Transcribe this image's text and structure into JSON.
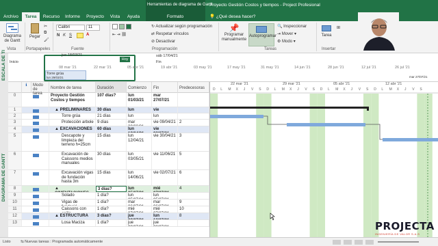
{
  "window": {
    "context_title": "Herramientas de diagrama de Gantt",
    "title": "Proyecto Gestión Costos y tiempos  -  Project Profesional"
  },
  "tabs": [
    {
      "label": "Archivo"
    },
    {
      "label": "Tarea"
    },
    {
      "label": "Recurso"
    },
    {
      "label": "Informe"
    },
    {
      "label": "Proyecto"
    },
    {
      "label": "Vista"
    },
    {
      "label": "Ayuda"
    },
    {
      "label": "Formato"
    }
  ],
  "tell_me": "¿Qué desea hacer?",
  "ribbon": {
    "gantt_label": "Diagrama de Gantt",
    "paste_label": "Pegar",
    "font_name": "Calibri",
    "font_size": "11",
    "bold": "N",
    "italic": "K",
    "underline": "S",
    "update_schedule": "Actualizar según programación",
    "respect_links": "Respetar vínculos",
    "deactivate": "Desactivar",
    "manual_schedule": "Programar manualmente",
    "auto_schedule": "Autoprogramar",
    "inspect": "Inspeccionar",
    "move": "Mover",
    "mode": "Modo",
    "task": "Tarea",
    "groups": {
      "vista": "Vista",
      "portapapeles": "Portapapeles",
      "fuente": "Fuente",
      "programacion": "Programación",
      "tareas": "Tareas",
      "insertar": "Insertar"
    }
  },
  "timeline": {
    "side_label": "ESCALA DE TI",
    "today_label": "Hoy",
    "start_date": "jue 18/03/21",
    "start_label": "Inicio",
    "end_label": "Fin",
    "end_date": "sáb 17/04/21",
    "task_name": "Torre grúa",
    "task_dates": "lun 29/03/21",
    "dates": [
      "08 mar '21",
      "22 mar '21",
      "05 abr '21",
      "19 abr '21",
      "03 may '21",
      "17 may '21",
      "31 may '21",
      "14 jun '21",
      "28 jun '21",
      "12 jul '21",
      "26 jul '21"
    ],
    "corner_date": "mar 27/07/21"
  },
  "grid": {
    "side_label": "DIAGRAMA DE GANTT",
    "headers": {
      "id": "",
      "info": "ℹ",
      "mode": "Modo de tarea",
      "name": "Nombre de tarea",
      "duration": "Duración",
      "start": "Comienzo",
      "finish": "Fin",
      "predecessors": "Predecesoras"
    },
    "rows": [
      {
        "id": "0",
        "name": "Proyecto Gestión Costos y tiempos",
        "duration": "107 días?",
        "start": "lun 01/03/21",
        "finish": "mar 27/07/21",
        "pred": "",
        "kind": "project"
      },
      {
        "id": "1",
        "name": "▲ PRELIMINARES",
        "duration": "30 días",
        "start": "lun 01/03/21",
        "finish": "vie 09/04/21",
        "pred": "",
        "kind": "phase"
      },
      {
        "id": "2",
        "name": "Torre grúa",
        "duration": "21 días",
        "start": "lun 01/03/21",
        "finish": "lun 29/03/21",
        "pred": "",
        "kind": "task"
      },
      {
        "id": "3",
        "name": "Protección arbole",
        "duration": "9 días",
        "start": "mar 30/03/21",
        "finish": "vie 09/04/21",
        "pred": "2",
        "kind": "task"
      },
      {
        "id": "4",
        "name": "▲ EXCAVACIONES",
        "duration": "60 días",
        "start": "lun 12/04/21",
        "finish": "vie 02/07/21",
        "pred": "",
        "kind": "phase"
      },
      {
        "id": "5",
        "name": "Descapote y limpieza del terreno h=25cm",
        "duration": "15 días",
        "start": "lun 12/04/21",
        "finish": "vie 30/04/21",
        "pred": "3",
        "kind": "task"
      },
      {
        "id": "6",
        "name": "Excavación de Caissons medios manuales",
        "duration": "30 días",
        "start": "lun 03/05/21",
        "finish": "vie 11/06/21",
        "pred": "5",
        "kind": "task"
      },
      {
        "id": "7",
        "name": "Excavación vigas de fundación hasta 3m",
        "duration": "15 días",
        "start": "lun 14/06/21",
        "finish": "vie 02/07/21",
        "pred": "6",
        "kind": "task"
      },
      {
        "id": "8",
        "name": "▲ CIMENTACIONES",
        "duration": "3 días?",
        "start": "lun 05/07/21",
        "finish": "mié 07/07/21",
        "pred": "4",
        "kind": "phase"
      },
      {
        "id": "9",
        "name": "Solado",
        "duration": "1 día?",
        "start": "lun 05/07/21",
        "finish": "lun 05/07/21",
        "pred": "",
        "kind": "task"
      },
      {
        "id": "10",
        "name": "Vigas de fundació",
        "duration": "1 día?",
        "start": "mar 06/07/21",
        "finish": "mar 06/07/21",
        "pred": "9",
        "kind": "task"
      },
      {
        "id": "11",
        "name": "Caissons con anillo",
        "duration": "1 día?",
        "start": "mié 07/07/21",
        "finish": "mié 07/07/21",
        "pred": "10",
        "kind": "task"
      },
      {
        "id": "12",
        "name": "▲ ESTRUCTURA",
        "duration": "3 días?",
        "start": "jue 08/07/21",
        "finish": "lun 12/07/21",
        "pred": "8",
        "kind": "phase"
      },
      {
        "id": "13",
        "name": "Losa Maciza",
        "duration": "1 día?",
        "start": "jue 08/07/21",
        "finish": "jue 08/07/21",
        "pred": "",
        "kind": "task"
      }
    ]
  },
  "chart": {
    "weeks": [
      "22 mar '21",
      "29 mar '21",
      "05 abr '21",
      "12 abr '21"
    ],
    "day_letters": [
      "D",
      "L",
      "M",
      "X",
      "J",
      "V",
      "S"
    ]
  },
  "status": {
    "ready": "Listo",
    "new_tasks": "Nuevas tareas : Programada automáticamente"
  },
  "logo": {
    "main": "PROJECTA",
    "sub": "INGENIERÍA DE VALOR S.A.S"
  },
  "colors": {
    "ribbon_green": "#217346",
    "bar_blue": "#7fa9dc",
    "weekend_green": "#cfe9c3",
    "summary_black": "#222222"
  }
}
